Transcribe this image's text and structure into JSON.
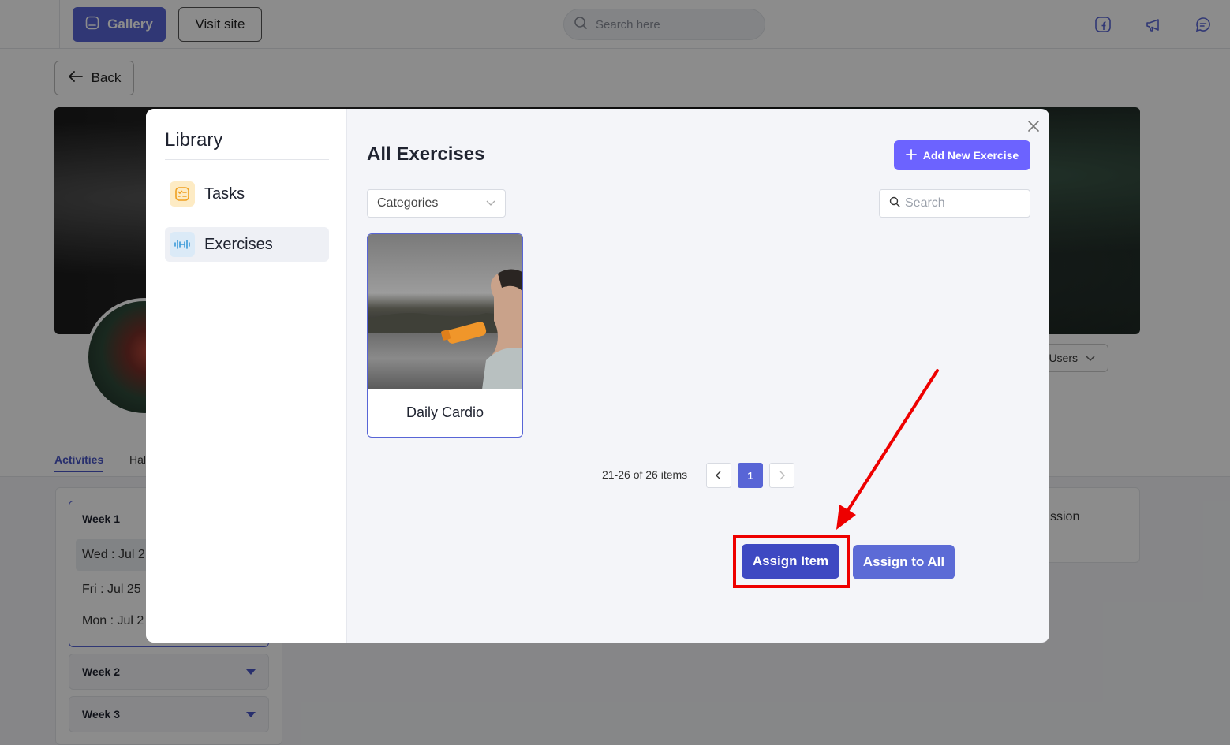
{
  "topbar": {
    "gallery_label": "Gallery",
    "visit_label": "Visit site",
    "search_placeholder": "Search here"
  },
  "page": {
    "back_label": "Back",
    "users_label": "l Users",
    "tabs": [
      "Activities",
      "Hal"
    ],
    "weeks": {
      "week1": "Week 1",
      "days": [
        "Wed : Jul 2",
        "Fri : Jul 25",
        "Mon : Jul 2"
      ],
      "week2": "Week 2",
      "week3": "Week 3"
    },
    "right_card_text": "ssion"
  },
  "modal": {
    "sidebar_title": "Library",
    "sidebar_items": [
      {
        "label": "Tasks",
        "icon": "tasks-icon"
      },
      {
        "label": "Exercises",
        "icon": "dumbbell-icon",
        "active": true
      }
    ],
    "title": "All Exercises",
    "add_button": "Add New Exercise",
    "category_select": "Categories",
    "search_placeholder": "Search",
    "cards": [
      {
        "title": "Daily Cardio"
      }
    ],
    "pagination": {
      "summary": "21-26 of 26 items",
      "current_page": "1"
    },
    "assign_item": "Assign Item",
    "assign_all": "Assign to All"
  },
  "colors": {
    "primary": "#5865d6",
    "accent": "#6c63ff",
    "annotation": "#ee0000"
  }
}
